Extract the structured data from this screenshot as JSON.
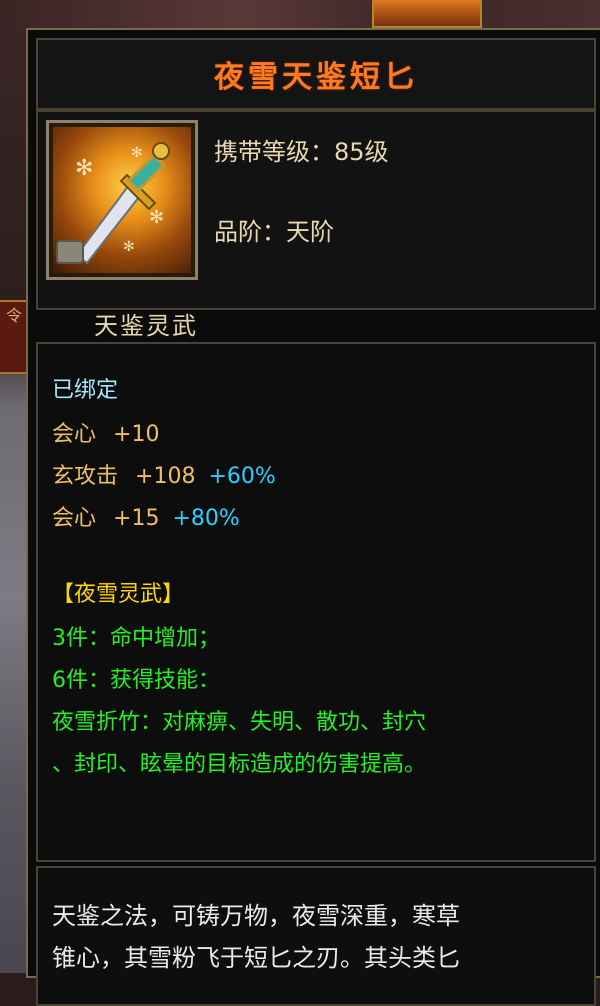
{
  "item": {
    "name": "夜雪天鉴短匕",
    "level_req": "携带等级：85级",
    "grade": "品阶：天阶",
    "category": "天鉴灵武",
    "icon": "dagger-icon"
  },
  "attributes": {
    "bound": "已绑定",
    "stats": [
      {
        "name": "会心",
        "base": "+10",
        "bonus": ""
      },
      {
        "name": "玄攻击",
        "base": "+108",
        "bonus": "+60%"
      },
      {
        "name": "会心",
        "base": "+15",
        "bonus": "+80%"
      }
    ]
  },
  "set": {
    "title": "【夜雪灵武】",
    "lines": [
      "3件：命中增加；",
      "6件：获得技能：",
      "夜雪折竹：对麻痹、失明、散功、封穴",
      "、封印、眩晕的目标造成的伤害提高。"
    ]
  },
  "description": {
    "lines": [
      "天鉴之法，可铸万物，夜雪深重，寒草",
      "锥心，其雪粉飞于短匕之刃。其头类匕"
    ]
  },
  "background": {
    "left_label": "令"
  },
  "colors": {
    "title": "#ff7a1e",
    "bound": "#a8e8ff",
    "stat": "#f0c060",
    "bonus": "#2ad0ff",
    "set_title": "#ffd800",
    "set_text": "#24f024"
  }
}
